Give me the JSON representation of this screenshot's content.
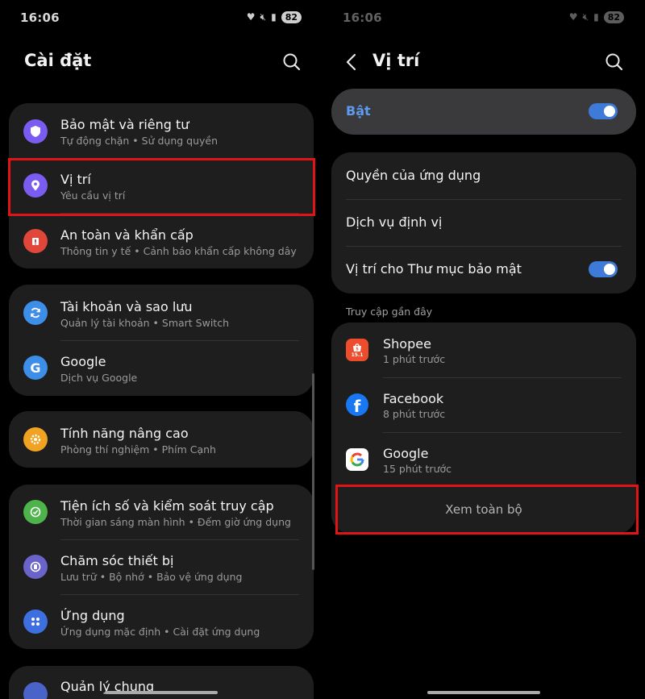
{
  "status": {
    "time": "16:06",
    "battery": "82"
  },
  "left": {
    "title": "Cài đặt",
    "groups": [
      {
        "items": [
          {
            "title": "Bảo mật và riêng tư",
            "subtitle": "Tự động chặn • Sử dụng quyền",
            "icon": "shield-icon",
            "color": "#7b5cf0"
          },
          {
            "title": "Vị trí",
            "subtitle": "Yêu cầu vị trí",
            "icon": "location-pin-icon",
            "color": "#7b5cf0"
          },
          {
            "title": "An toàn và khẩn cấp",
            "subtitle": "Thông tin y tế • Cảnh báo khẩn cấp không dây",
            "icon": "emergency-icon",
            "color": "#e0463a"
          }
        ]
      },
      {
        "items": [
          {
            "title": "Tài khoản và sao lưu",
            "subtitle": "Quản lý tài khoản • Smart Switch",
            "icon": "sync-icon",
            "color": "#3d8ee8"
          },
          {
            "title": "Google",
            "subtitle": "Dịch vụ Google",
            "icon": "google-g-icon",
            "color": "#3d8ee8"
          }
        ]
      },
      {
        "items": [
          {
            "title": "Tính năng nâng cao",
            "subtitle": "Phòng thí nghiệm • Phím Cạnh",
            "icon": "gear-plus-icon",
            "color": "#f0a223"
          }
        ]
      },
      {
        "items": [
          {
            "title": "Tiện ích số và kiểm soát truy cập",
            "subtitle": "Thời gian sáng màn hình • Đếm giờ ứng dụng",
            "icon": "digital-wellbeing-icon",
            "color": "#4db34a"
          },
          {
            "title": "Chăm sóc thiết bị",
            "subtitle": "Lưu trữ • Bộ nhớ • Bảo vệ ứng dụng",
            "icon": "device-care-icon",
            "color": "#6a63c9"
          },
          {
            "title": "Ứng dụng",
            "subtitle": "Ứng dụng mặc định • Cài đặt ứng dụng",
            "icon": "apps-grid-icon",
            "color": "#3d6fe0"
          }
        ]
      },
      {
        "items": [
          {
            "title": "Quản lý chung",
            "subtitle": "",
            "icon": "general-management-icon",
            "color": "#4a63c9"
          }
        ]
      }
    ]
  },
  "right": {
    "title": "Vị trí",
    "master_toggle_label": "Bật",
    "options": [
      {
        "label": "Quyền của ứng dụng"
      },
      {
        "label": "Dịch vụ định vị"
      },
      {
        "label": "Vị trí cho Thư mục bảo mật"
      }
    ],
    "recent_label": "Truy cập gần đây",
    "recent_apps": [
      {
        "name": "Shopee",
        "time": "1 phút trước",
        "icon": "shopee-icon"
      },
      {
        "name": "Facebook",
        "time": "8 phút trước",
        "icon": "facebook-icon"
      },
      {
        "name": "Google",
        "time": "15 phút trước",
        "icon": "google-icon"
      }
    ],
    "see_all": "Xem toàn bộ",
    "shopee_badge": "15.1"
  },
  "colors": {
    "accent": "#3e7bd8",
    "highlight": "#e01414",
    "card": "#1e1e1e"
  }
}
